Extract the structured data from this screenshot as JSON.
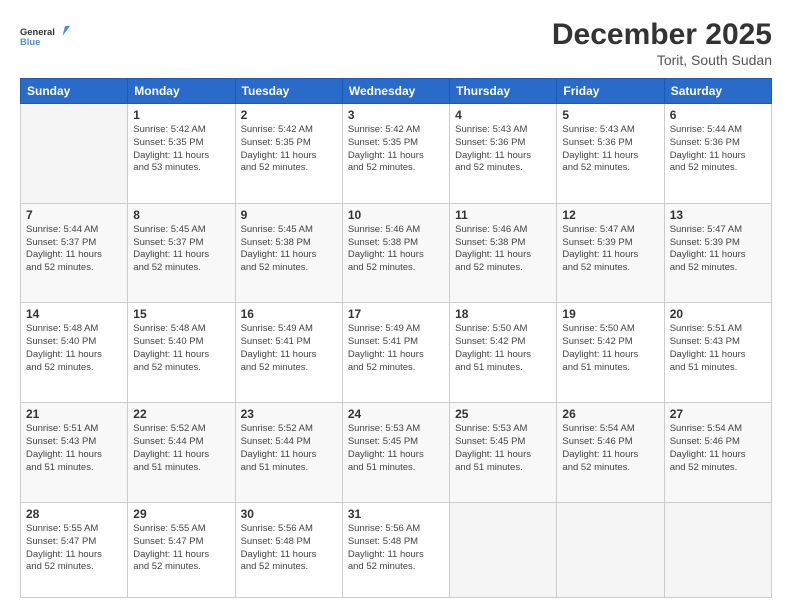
{
  "header": {
    "logo_general": "General",
    "logo_blue": "Blue",
    "month": "December 2025",
    "location": "Torit, South Sudan"
  },
  "days_of_week": [
    "Sunday",
    "Monday",
    "Tuesday",
    "Wednesday",
    "Thursday",
    "Friday",
    "Saturday"
  ],
  "weeks": [
    [
      {
        "day": "",
        "info": ""
      },
      {
        "day": "1",
        "info": "Sunrise: 5:42 AM\nSunset: 5:35 PM\nDaylight: 11 hours\nand 53 minutes."
      },
      {
        "day": "2",
        "info": "Sunrise: 5:42 AM\nSunset: 5:35 PM\nDaylight: 11 hours\nand 52 minutes."
      },
      {
        "day": "3",
        "info": "Sunrise: 5:42 AM\nSunset: 5:35 PM\nDaylight: 11 hours\nand 52 minutes."
      },
      {
        "day": "4",
        "info": "Sunrise: 5:43 AM\nSunset: 5:36 PM\nDaylight: 11 hours\nand 52 minutes."
      },
      {
        "day": "5",
        "info": "Sunrise: 5:43 AM\nSunset: 5:36 PM\nDaylight: 11 hours\nand 52 minutes."
      },
      {
        "day": "6",
        "info": "Sunrise: 5:44 AM\nSunset: 5:36 PM\nDaylight: 11 hours\nand 52 minutes."
      }
    ],
    [
      {
        "day": "7",
        "info": "Sunrise: 5:44 AM\nSunset: 5:37 PM\nDaylight: 11 hours\nand 52 minutes."
      },
      {
        "day": "8",
        "info": "Sunrise: 5:45 AM\nSunset: 5:37 PM\nDaylight: 11 hours\nand 52 minutes."
      },
      {
        "day": "9",
        "info": "Sunrise: 5:45 AM\nSunset: 5:38 PM\nDaylight: 11 hours\nand 52 minutes."
      },
      {
        "day": "10",
        "info": "Sunrise: 5:46 AM\nSunset: 5:38 PM\nDaylight: 11 hours\nand 52 minutes."
      },
      {
        "day": "11",
        "info": "Sunrise: 5:46 AM\nSunset: 5:38 PM\nDaylight: 11 hours\nand 52 minutes."
      },
      {
        "day": "12",
        "info": "Sunrise: 5:47 AM\nSunset: 5:39 PM\nDaylight: 11 hours\nand 52 minutes."
      },
      {
        "day": "13",
        "info": "Sunrise: 5:47 AM\nSunset: 5:39 PM\nDaylight: 11 hours\nand 52 minutes."
      }
    ],
    [
      {
        "day": "14",
        "info": "Sunrise: 5:48 AM\nSunset: 5:40 PM\nDaylight: 11 hours\nand 52 minutes."
      },
      {
        "day": "15",
        "info": "Sunrise: 5:48 AM\nSunset: 5:40 PM\nDaylight: 11 hours\nand 52 minutes."
      },
      {
        "day": "16",
        "info": "Sunrise: 5:49 AM\nSunset: 5:41 PM\nDaylight: 11 hours\nand 52 minutes."
      },
      {
        "day": "17",
        "info": "Sunrise: 5:49 AM\nSunset: 5:41 PM\nDaylight: 11 hours\nand 52 minutes."
      },
      {
        "day": "18",
        "info": "Sunrise: 5:50 AM\nSunset: 5:42 PM\nDaylight: 11 hours\nand 51 minutes."
      },
      {
        "day": "19",
        "info": "Sunrise: 5:50 AM\nSunset: 5:42 PM\nDaylight: 11 hours\nand 51 minutes."
      },
      {
        "day": "20",
        "info": "Sunrise: 5:51 AM\nSunset: 5:43 PM\nDaylight: 11 hours\nand 51 minutes."
      }
    ],
    [
      {
        "day": "21",
        "info": "Sunrise: 5:51 AM\nSunset: 5:43 PM\nDaylight: 11 hours\nand 51 minutes."
      },
      {
        "day": "22",
        "info": "Sunrise: 5:52 AM\nSunset: 5:44 PM\nDaylight: 11 hours\nand 51 minutes."
      },
      {
        "day": "23",
        "info": "Sunrise: 5:52 AM\nSunset: 5:44 PM\nDaylight: 11 hours\nand 51 minutes."
      },
      {
        "day": "24",
        "info": "Sunrise: 5:53 AM\nSunset: 5:45 PM\nDaylight: 11 hours\nand 51 minutes."
      },
      {
        "day": "25",
        "info": "Sunrise: 5:53 AM\nSunset: 5:45 PM\nDaylight: 11 hours\nand 51 minutes."
      },
      {
        "day": "26",
        "info": "Sunrise: 5:54 AM\nSunset: 5:46 PM\nDaylight: 11 hours\nand 52 minutes."
      },
      {
        "day": "27",
        "info": "Sunrise: 5:54 AM\nSunset: 5:46 PM\nDaylight: 11 hours\nand 52 minutes."
      }
    ],
    [
      {
        "day": "28",
        "info": "Sunrise: 5:55 AM\nSunset: 5:47 PM\nDaylight: 11 hours\nand 52 minutes."
      },
      {
        "day": "29",
        "info": "Sunrise: 5:55 AM\nSunset: 5:47 PM\nDaylight: 11 hours\nand 52 minutes."
      },
      {
        "day": "30",
        "info": "Sunrise: 5:56 AM\nSunset: 5:48 PM\nDaylight: 11 hours\nand 52 minutes."
      },
      {
        "day": "31",
        "info": "Sunrise: 5:56 AM\nSunset: 5:48 PM\nDaylight: 11 hours\nand 52 minutes."
      },
      {
        "day": "",
        "info": ""
      },
      {
        "day": "",
        "info": ""
      },
      {
        "day": "",
        "info": ""
      }
    ]
  ]
}
